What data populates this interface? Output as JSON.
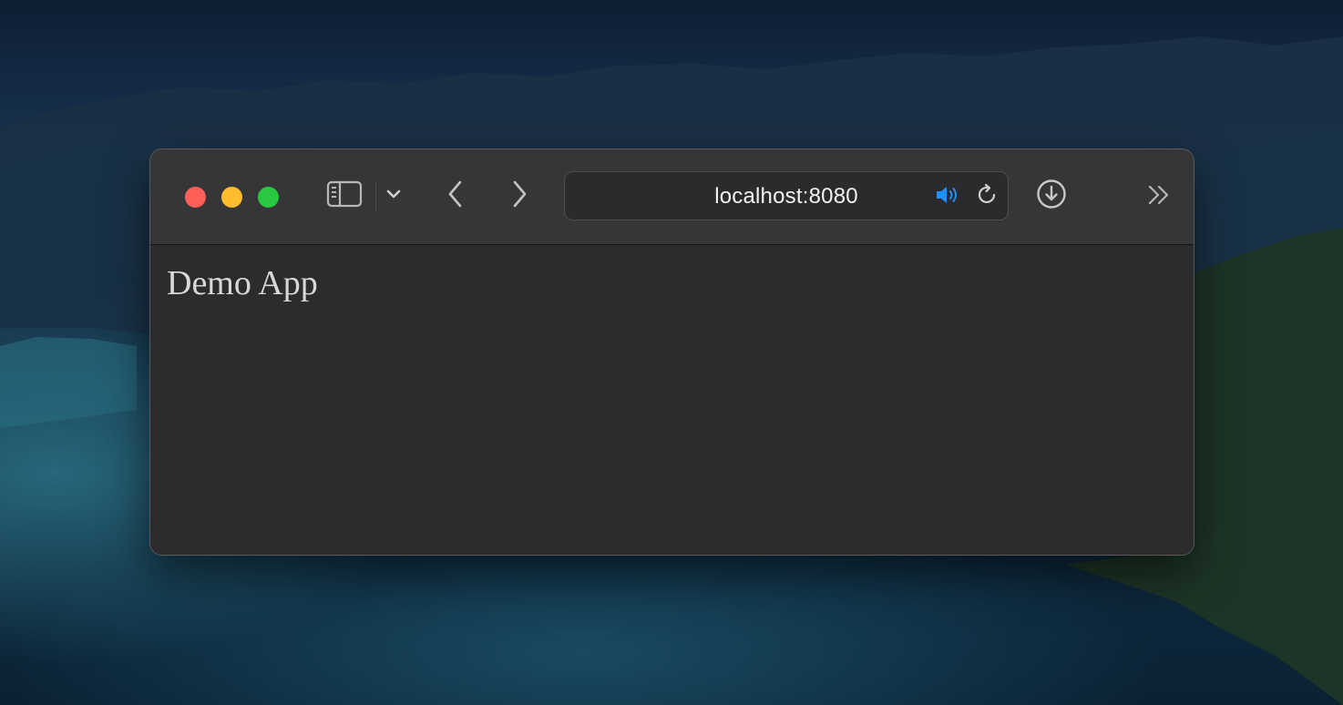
{
  "browser": {
    "address_bar": {
      "url": "localhost:8080"
    },
    "icons": {
      "sidebar": "sidebar-icon",
      "dropdown": "chevron-down-icon",
      "back": "back-arrow-icon",
      "forward": "forward-arrow-icon",
      "audio": "speaker-icon",
      "reload": "reload-icon",
      "downloads": "download-icon",
      "overflow": "double-chevron-icon"
    },
    "colors": {
      "close": "#fe5f57",
      "minimize": "#febc2e",
      "zoom": "#28c840",
      "audio_accent": "#1e90ff"
    }
  },
  "page": {
    "heading": "Demo App"
  }
}
